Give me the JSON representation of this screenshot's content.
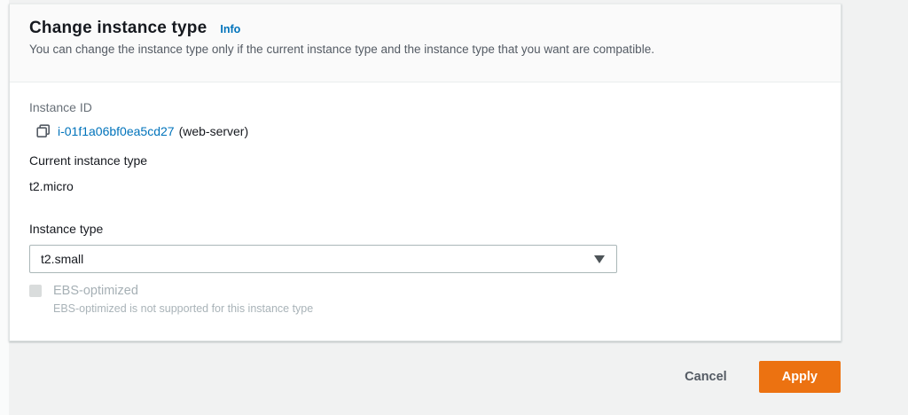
{
  "dialog": {
    "title": "Change instance type",
    "info_label": "Info",
    "description": "You can change the instance type only if the current instance type and the instance type that you want are compatible.",
    "fields": {
      "instance_id_label": "Instance ID",
      "instance_id_link": "i-01f1a06bf0ea5cd27",
      "instance_name": "(web-server)",
      "current_type_label": "Current instance type",
      "current_type_value": "t2.micro",
      "instance_type_label": "Instance type",
      "instance_type_selected": "t2.small",
      "ebs_checkbox": {
        "label": "EBS-optimized",
        "helper": "EBS-optimized is not supported for this instance type",
        "state": "disabled-unchecked"
      }
    },
    "footer": {
      "cancel_label": "Cancel",
      "apply_label": "Apply"
    },
    "icons": {
      "copy_icon": "copy (overlapping squares)",
      "caret_down_icon": "solid triangle down"
    },
    "colors": {
      "accent_button": "#ec7211",
      "link": "#0073bb",
      "text": "#16191f",
      "muted_text": "#687078",
      "disabled_text": "#a6b0b5",
      "input_border": "#aab7b8",
      "page_background": "#f1f2f2",
      "header_background": "#fafafa"
    }
  }
}
